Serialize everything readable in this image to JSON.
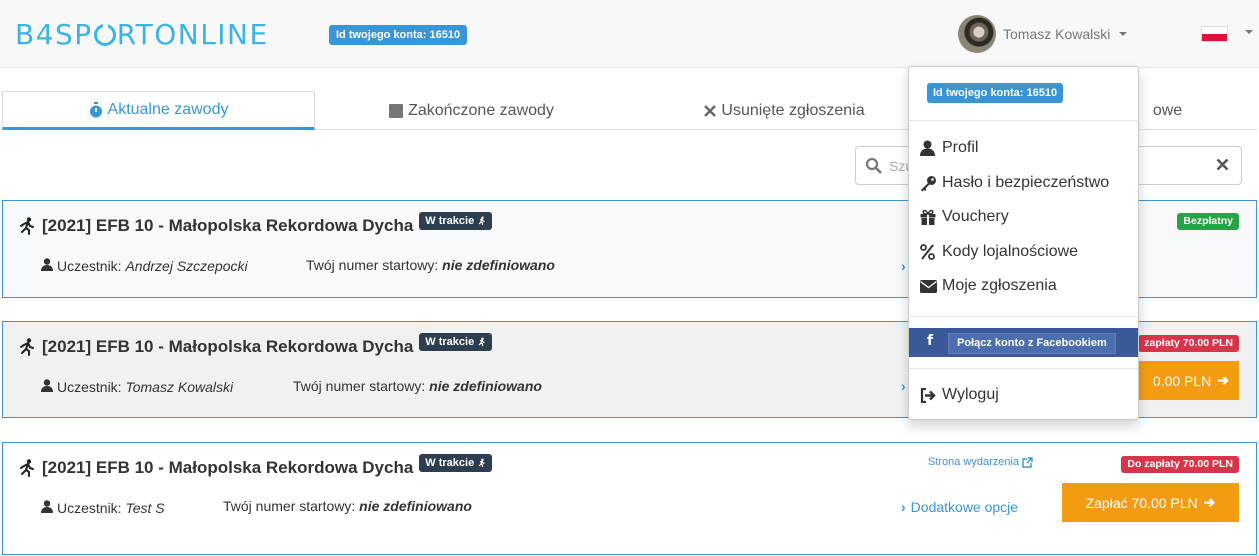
{
  "header": {
    "logo": {
      "part1": "B4SP",
      "part2": "RT",
      "part3": "ONLINE"
    },
    "account_badge": "Id twojego konta: 16510",
    "user_name": "Tomasz Kowalski"
  },
  "tabs": [
    {
      "label": "Aktualne zawody",
      "icon": "stopwatch-icon",
      "active": true
    },
    {
      "label": "Zakończone zawody",
      "icon": "stop-square-icon",
      "active": false
    },
    {
      "label": "Usunięte zgłoszenia",
      "icon": "times-icon",
      "active": false
    },
    {
      "label": "owe",
      "icon": "",
      "active": false
    }
  ],
  "search": {
    "placeholder": "Szukaj"
  },
  "cards": [
    {
      "title": "[2021] EFB 10 - Małopolska Rekordowa Dycha",
      "status": "W trakcie",
      "participant_label": "Uczestnik:",
      "participant": "Andrzej Szczepocki",
      "number_label": "Twój numer startowy:",
      "number": "nie zdefiniowano",
      "price_badge": "Bezpłatny"
    },
    {
      "title": "[2021] EFB 10 - Małopolska Rekordowa Dycha",
      "status": "W trakcie",
      "participant_label": "Uczestnik:",
      "participant": "Tomasz Kowalski",
      "number_label": "Twój numer startowy:",
      "number": "nie zdefiniowano",
      "price_badge": "zapłaty 70.00 PLN",
      "pay_button": "0.00 PLN"
    },
    {
      "title": "[2021] EFB 10 - Małopolska Rekordowa Dycha",
      "status": "W trakcie",
      "participant_label": "Uczestnik:",
      "participant": "Test S",
      "number_label": "Twój numer startowy:",
      "number": "nie zdefiniowano",
      "event_link": "Strona wydarzenia",
      "price_badge": "Do zapłaty 70.00 PLN",
      "more_link": "Dodatkowe opcje",
      "pay_button": "Zapłać 70.00 PLN"
    }
  ],
  "dropdown": {
    "account_badge": "Id twojego konta: 16510",
    "items": [
      {
        "label": "Profil",
        "icon": "user-icon"
      },
      {
        "label": "Hasło i bezpieczeństwo",
        "icon": "key-icon"
      },
      {
        "label": "Vouchery",
        "icon": "gift-icon"
      },
      {
        "label": "Kody lojalnościowe",
        "icon": "percent-icon"
      },
      {
        "label": "Moje zgłoszenia",
        "icon": "envelope-icon"
      }
    ],
    "facebook_glyph": "f",
    "facebook_button": "Połącz konto z Facebookiem",
    "logout": "Wyloguj"
  },
  "colors": {
    "primary": "#3a95d4",
    "logo": "#3db3e3",
    "dark_badge": "#2d3e50",
    "success": "#27a244",
    "danger": "#d8354a",
    "warning": "#f39c12",
    "facebook": "#3b5998"
  }
}
